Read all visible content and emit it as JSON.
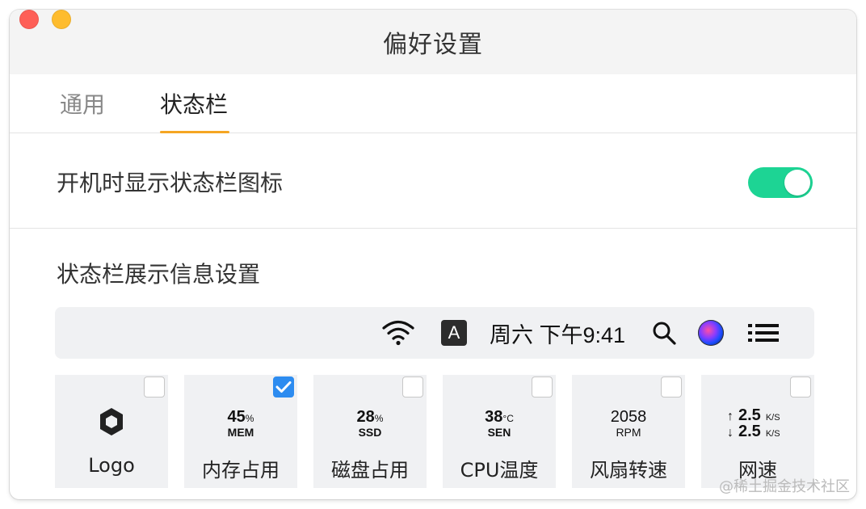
{
  "window": {
    "title": "偏好设置"
  },
  "tabs": [
    {
      "label": "通用",
      "active": false
    },
    {
      "label": "状态栏",
      "active": true
    }
  ],
  "boot_row": {
    "label": "开机时显示状态栏图标",
    "toggle_on": true
  },
  "section": {
    "title": "状态栏展示信息设置"
  },
  "menubar_preview": {
    "input_source": "A",
    "time": "周六 下午9:41",
    "icons": [
      "wifi-icon",
      "input-source-icon",
      "search-icon",
      "siri-icon",
      "menu-list-icon"
    ]
  },
  "cards": [
    {
      "label": "Logo",
      "checked": false,
      "icon": "hexagon-logo-icon"
    },
    {
      "label": "内存占用",
      "checked": true,
      "value": "45",
      "unit": "%",
      "sub": "MEM"
    },
    {
      "label": "磁盘占用",
      "checked": false,
      "value": "28",
      "unit": "%",
      "sub": "SSD"
    },
    {
      "label": "CPU温度",
      "checked": false,
      "value": "38",
      "unit": "°C",
      "sub": "SEN"
    },
    {
      "label": "风扇转速",
      "checked": false,
      "value": "2058",
      "unit": "",
      "sub": "RPM"
    },
    {
      "label": "网速",
      "checked": false,
      "up": "2.5",
      "down": "2.5",
      "unit": "K/S"
    }
  ],
  "watermark": "@稀土掘金技术社区",
  "colors": {
    "accent_underline": "#f5a623",
    "toggle_on": "#1dd494",
    "checkbox_checked": "#2d8cf0"
  }
}
